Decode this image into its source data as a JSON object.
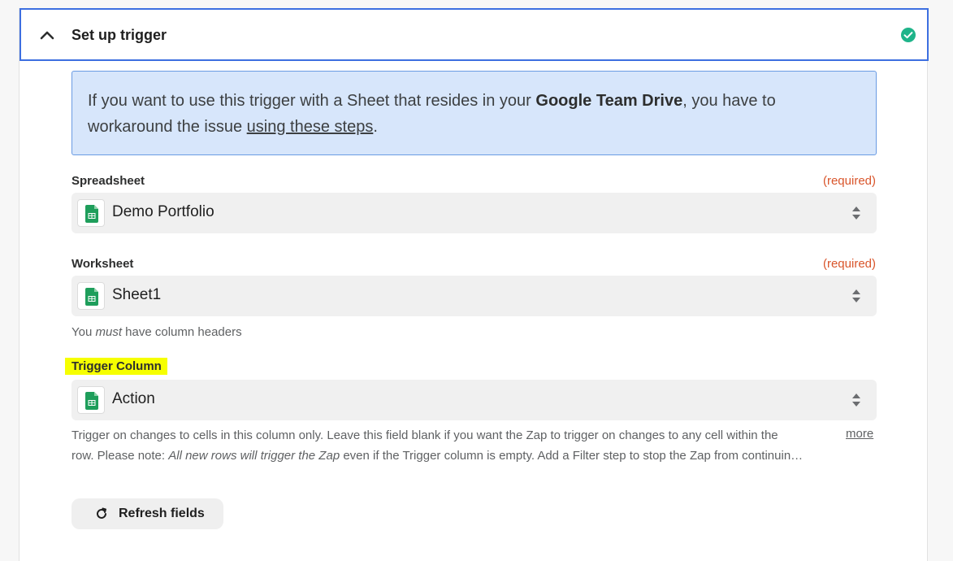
{
  "step": {
    "title": "Set up trigger",
    "status_icon": "check-circle-icon"
  },
  "notice": {
    "text_before": "If you want to use this trigger with a Sheet that resides in your ",
    "bold_text": "Google Team Drive",
    "text_middle": ", you have to workaround the issue ",
    "link_text": "using these steps",
    "text_after": "."
  },
  "fields": {
    "spreadsheet": {
      "label": "Spreadsheet",
      "required_text": "(required)",
      "value": "Demo Portfolio",
      "icon": "google-sheets-icon"
    },
    "worksheet": {
      "label": "Worksheet",
      "required_text": "(required)",
      "value": "Sheet1",
      "icon": "google-sheets-icon",
      "help_before": "You ",
      "help_italic": "must",
      "help_after": " have column headers"
    },
    "trigger_column": {
      "label": "Trigger Column",
      "value": "Action",
      "icon": "google-sheets-icon",
      "help_line1": "Trigger on changes to cells in this column only. Leave this field blank if you want the Zap to trigger on changes to any cell within the",
      "help_line2_before": "row. Please note: ",
      "help_line2_italic": "All new rows will trigger the Zap",
      "help_line2_after": " even if the Trigger column is empty. Add a Filter step to stop the Zap from continuin…",
      "more_label": "more"
    }
  },
  "refresh_button": {
    "label": "Refresh fields",
    "icon": "refresh-icon"
  },
  "colors": {
    "accent_border": "#3d6fe0",
    "success": "#1fb48a",
    "required": "#d9552b",
    "notice_bg": "#d7e6fb",
    "highlight": "#f6ff00",
    "sheets_green": "#1e9e5b"
  }
}
